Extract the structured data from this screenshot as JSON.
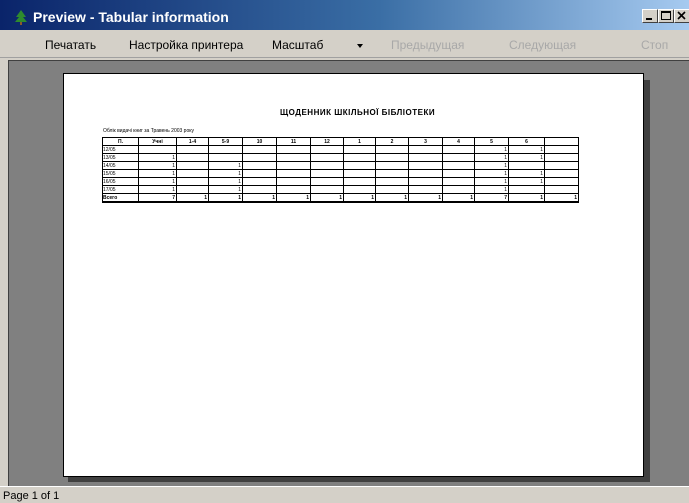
{
  "window": {
    "title": "Preview - Tabular information"
  },
  "toolbar": {
    "print": "Печатать",
    "printer_setup": "Настройка принтера",
    "scale": "Масштаб",
    "previous": "Предыдущая",
    "next": "Следующая",
    "stop": "Стоп"
  },
  "document": {
    "title": "ЩОДЕННИК ШКІЛЬНОЇ БІБЛІОТЕКИ",
    "subtitle": "Облік видачі книг за Травень 2003 року",
    "columns": [
      "П.",
      "Учні",
      "1-4",
      "5-9",
      "10",
      "11",
      "12",
      "1",
      "2",
      "3",
      "4",
      "5",
      "6"
    ],
    "rows": [
      {
        "label": "12/05",
        "values": [
          "",
          "",
          "",
          "",
          "",
          "",
          "",
          "",
          "",
          "",
          "1",
          "1"
        ]
      },
      {
        "label": "13/05",
        "values": [
          "1",
          "",
          "",
          "",
          "",
          "",
          "",
          "",
          "",
          "",
          "1",
          "1"
        ]
      },
      {
        "label": "14/05",
        "values": [
          "1",
          "",
          "1",
          "",
          "",
          "",
          "",
          "",
          "",
          "",
          "1",
          ""
        ]
      },
      {
        "label": "15/05",
        "values": [
          "1",
          "",
          "1",
          "",
          "",
          "",
          "",
          "",
          "",
          "",
          "1",
          "1"
        ]
      },
      {
        "label": "16/05",
        "values": [
          "1",
          "",
          "1",
          "",
          "",
          "",
          "",
          "",
          "",
          "",
          "1",
          "1"
        ]
      },
      {
        "label": "17/05",
        "values": [
          "1",
          "",
          "1",
          "",
          "",
          "",
          "",
          "",
          "",
          "",
          "1",
          ""
        ]
      }
    ],
    "total": {
      "label": "Всего",
      "values": [
        "7",
        "1",
        "1",
        "1",
        "1",
        "1",
        "1",
        "1",
        "1",
        "1",
        "7",
        "1",
        "1"
      ]
    }
  },
  "status": {
    "page": "Page 1 of 1"
  },
  "colors": {
    "title_gradient_start": "#0a246a",
    "title_gradient_end": "#a6caf0",
    "chrome": "#d4d0c8",
    "preview_background": "#808080"
  },
  "icons": {
    "app": "green-tree-icon",
    "minimize": "minimize-icon",
    "maximize": "maximize-icon",
    "close": "close-icon",
    "dropdown": "chevron-down-icon"
  }
}
